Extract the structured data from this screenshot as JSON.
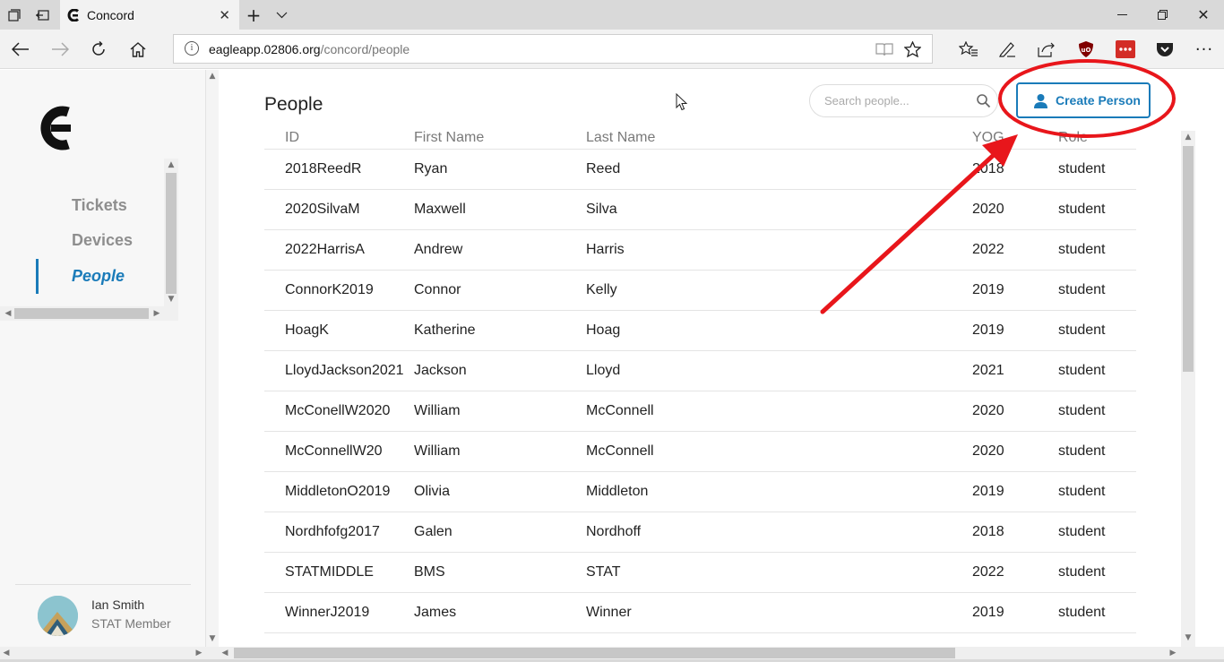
{
  "browser": {
    "tab_title": "Concord",
    "url_domain": "eagleapp.02806.org",
    "url_path": "/concord/people"
  },
  "sidebar": {
    "items": [
      {
        "label": "Tickets",
        "active": false
      },
      {
        "label": "Devices",
        "active": false
      },
      {
        "label": "People",
        "active": true
      }
    ],
    "user": {
      "name": "Ian Smith",
      "role": "STAT Member"
    }
  },
  "main": {
    "title": "People",
    "search_placeholder": "Search people...",
    "create_button": "Create Person",
    "columns": [
      "ID",
      "First Name",
      "Last Name",
      "YOG",
      "Role"
    ],
    "rows": [
      [
        "2018ReedR",
        "Ryan",
        "Reed",
        "2018",
        "student"
      ],
      [
        "2020SilvaM",
        "Maxwell",
        "Silva",
        "2020",
        "student"
      ],
      [
        "2022HarrisA",
        "Andrew",
        "Harris",
        "2022",
        "student"
      ],
      [
        "ConnorK2019",
        "Connor",
        "Kelly",
        "2019",
        "student"
      ],
      [
        "HoagK",
        "Katherine",
        "Hoag",
        "2019",
        "student"
      ],
      [
        "LloydJackson2021",
        "Jackson",
        "Lloyd",
        "2021",
        "student"
      ],
      [
        "McConellW2020",
        "William",
        "McConnell",
        "2020",
        "student"
      ],
      [
        "McConnellW20",
        "William",
        "McConnell",
        "2020",
        "student"
      ],
      [
        "MiddletonO2019",
        "Olivia",
        "Middleton",
        "2019",
        "student"
      ],
      [
        "Nordhfofg2017",
        "Galen",
        "Nordhoff",
        "2018",
        "student"
      ],
      [
        "STATMIDDLE",
        "BMS",
        "STAT",
        "2022",
        "student"
      ],
      [
        "WinnerJ2019",
        "James",
        "Winner",
        "2019",
        "student"
      ]
    ]
  },
  "colors": {
    "accent": "#1a7bb9",
    "annotation": "#e8161b"
  }
}
